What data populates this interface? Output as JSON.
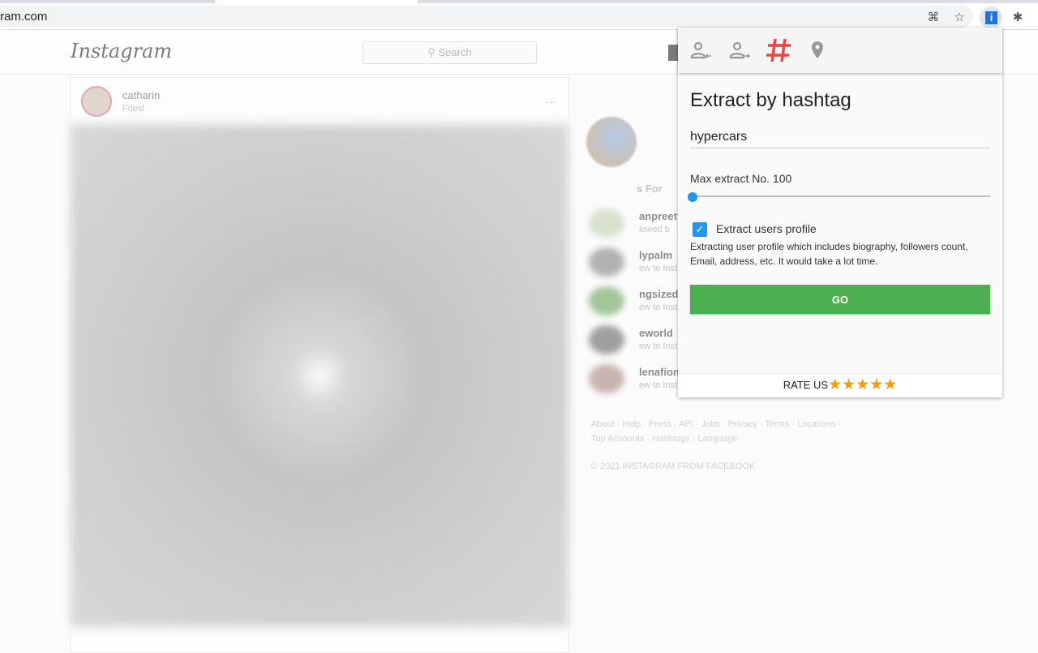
{
  "browser": {
    "url": "ram.com",
    "icons": [
      "translate-icon",
      "star-icon",
      "extension-info-icon",
      "puzzle-icon"
    ]
  },
  "instagram": {
    "logo": "Instagram",
    "search_placeholder": "Search",
    "post": {
      "username": "catharin",
      "location": "Friesl",
      "more": "..."
    },
    "suggestions_header": "s For",
    "suggestions": [
      {
        "name": "anpreet",
        "sub": "lowed b"
      },
      {
        "name": "lypalm",
        "sub": "ew to Inst"
      },
      {
        "name": "ngsized",
        "sub": "ew to Inst"
      },
      {
        "name": "eworld",
        "sub": "ew to Inst"
      },
      {
        "name": "lenafion",
        "sub": "ew to Inst"
      }
    ],
    "footer_links_1": "About · Help · Press · API · Jobs · Privacy · Terms · Locations ·",
    "footer_links_2": "Top Accounts · Hashtags · Language",
    "copyright": "© 2021 INSTAGRAM FROM FACEBOOK"
  },
  "popup": {
    "tabs": [
      {
        "icon": "user-followers-icon"
      },
      {
        "icon": "user-following-icon"
      },
      {
        "icon": "hashtag-icon",
        "active": true
      },
      {
        "icon": "location-pin-icon"
      }
    ],
    "title": "Extract by hashtag",
    "hashtag_value": "hypercars",
    "max_label": "Max extract No. 100",
    "max_value": 100,
    "checkbox_label": "Extract users profile",
    "checkbox_checked": true,
    "description": "Extracting user profile which includes biography, followers count, Email, address, etc. It would take a lot time.",
    "go_label": "GO",
    "rate_label": "RATE US",
    "stars": "★★★★★",
    "colors": {
      "active_tab": "#e84545",
      "accent": "#2196f3",
      "go": "#4caf50",
      "star": "#f39c12"
    }
  }
}
